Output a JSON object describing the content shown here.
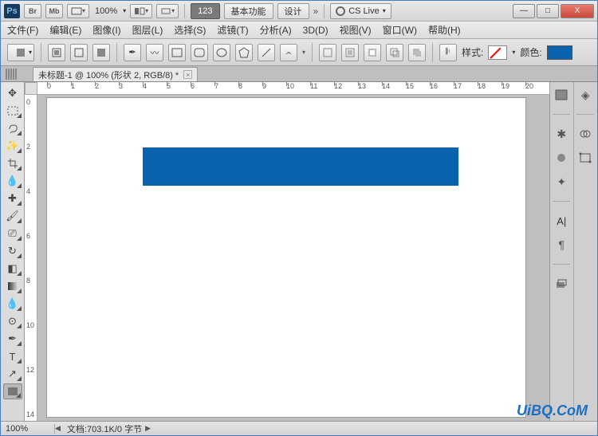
{
  "titlebar": {
    "zoom": "100%",
    "ws_123": "123",
    "ws_basic": "基本功能",
    "ws_design": "设计",
    "more": "»",
    "cs_live": "CS Live",
    "min": "—",
    "max": "□",
    "close": "X"
  },
  "menu": {
    "file": "文件(F)",
    "edit": "编辑(E)",
    "image": "图像(I)",
    "layer": "图层(L)",
    "select": "选择(S)",
    "filter": "滤镜(T)",
    "analysis": "分析(A)",
    "threed": "3D(D)",
    "view": "视图(V)",
    "window": "窗口(W)",
    "help": "帮助(H)"
  },
  "options": {
    "style_label": "样式:",
    "color_label": "颜色:",
    "color_hex": "#0a63af"
  },
  "tab": {
    "title": "未标题-1 @ 100% (形状 2, RGB/8) *"
  },
  "ruler": {
    "h": [
      "0",
      "1",
      "2",
      "3",
      "4",
      "5",
      "6",
      "7",
      "8",
      "9",
      "10",
      "11",
      "12",
      "13",
      "14",
      "15",
      "16",
      "17",
      "18",
      "19",
      "20"
    ],
    "v": [
      "0",
      "2",
      "4",
      "6",
      "8",
      "10",
      "12",
      "14"
    ]
  },
  "status": {
    "zoom": "100%",
    "doc": "文档:703.1K/0 字节"
  },
  "watermark": "UiBQ.CoM",
  "chart_data": null
}
